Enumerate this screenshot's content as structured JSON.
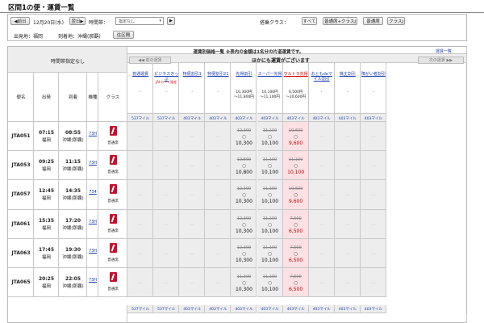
{
  "title": "区間1の便・運賃一覧",
  "search": {
    "prev_day": "◀前日",
    "date": "12月20日(水)",
    "next_day": "翌日▶",
    "time_label": "時間帯：",
    "time_value": "指定なし",
    "go": "▶",
    "class_label": "搭乗クラス：",
    "classes": [
      "すべて",
      "普通席+クラスJ",
      "普通席",
      "クラスJ"
    ],
    "origin": "出発地：福岡",
    "dest": "到着地：沖縄(那覇)",
    "reverse": "往区間"
  },
  "header": {
    "time_unspecified": "時間帯指定なし",
    "fare_title": "運賃別価格一覧 ※表内の金額は1名分の片道運賃です。",
    "fare_list_link": "運賃一覧",
    "prev_fares": "◀◀ 前の運賃",
    "other_fares": "ほかにも運賃がございます",
    "next_fares": "次の運賃 ▶▶",
    "col_flight": "便名",
    "col_dep": "出発",
    "col_arr": "到着",
    "col_aircraft": "機種",
    "col_class": "クラス"
  },
  "fares": [
    {
      "name": "普通運賃",
      "note": "",
      "price": "-",
      "red": false
    },
    {
      "name": "ビジネスきっぷ",
      "note": "JALカード限定",
      "price": "-",
      "red": false
    },
    {
      "name": "特便割引1",
      "note": "",
      "price": "-",
      "red": false
    },
    {
      "name": "特便割引21",
      "note": "",
      "price": "-",
      "red": false
    },
    {
      "name": "先得割引",
      "note": "",
      "price": "10,300円\n〜11,800円",
      "red": false
    },
    {
      "name": "スーパー先得",
      "note": "",
      "price": "10,100円\n〜11,100円",
      "red": false
    },
    {
      "name": "ウルトラ先得",
      "note": "",
      "price": "6,500円\n〜10,600円",
      "red": true
    },
    {
      "name": "おともdeマイル割引",
      "note": "",
      "price": "-",
      "red": false
    },
    {
      "name": "株主割引",
      "note": "",
      "price": "-",
      "red": false
    },
    {
      "name": "障がい者割引",
      "note": "",
      "price": "-",
      "red": false
    }
  ],
  "miles": [
    "537マイル",
    "537マイル",
    "403マイル",
    "403マイル",
    "403マイル",
    "403マイル",
    "403マイル",
    "403マイル",
    "403マイル",
    "403マイル"
  ],
  "class_name": "普通席",
  "flights": [
    {
      "no": "JTA051",
      "dep": "07:15",
      "from": "福岡",
      "arr": "08:55",
      "to": "沖縄(那覇)",
      "aircraft": "73H",
      "sakitoku": {
        "top": "12,300",
        "mark": "○",
        "price": "10,300"
      },
      "super": {
        "top": "11,100",
        "mark": "○",
        "price": "10,100"
      },
      "ultra": {
        "top": "10,600",
        "mark": "○",
        "price": "9,600"
      }
    },
    {
      "no": "JTA053",
      "dep": "09:25",
      "from": "福岡",
      "arr": "11:15",
      "to": "沖縄(那覇)",
      "aircraft": "73H",
      "sakitoku": {
        "top": "12,800",
        "mark": "○",
        "price": "10,800"
      },
      "super": {
        "top": "11,100",
        "mark": "○",
        "price": "10,100"
      },
      "ultra": {
        "top": "11,100",
        "mark": "○",
        "price": "10,100"
      }
    },
    {
      "no": "JTA057",
      "dep": "12:45",
      "from": "福岡",
      "arr": "14:35",
      "to": "沖縄(那覇)",
      "aircraft": "734",
      "sakitoku": {
        "top": "12,300",
        "mark": "○",
        "price": "10,300"
      },
      "super": {
        "top": "11,100",
        "mark": "○",
        "price": "10,100"
      },
      "ultra": {
        "top": "10,600",
        "mark": "○",
        "price": "9,600"
      }
    },
    {
      "no": "JTA061",
      "dep": "15:35",
      "from": "福岡",
      "arr": "17:20",
      "to": "沖縄(那覇)",
      "aircraft": "73H",
      "sakitoku": {
        "top": "12,300",
        "mark": "○",
        "price": "10,300"
      },
      "super": {
        "top": "11,100",
        "mark": "○",
        "price": "10,100"
      },
      "ultra": {
        "top": "7,500",
        "mark": "○",
        "price": "6,500"
      }
    },
    {
      "no": "JTA063",
      "dep": "17:45",
      "from": "福岡",
      "arr": "19:30",
      "to": "沖縄(那覇)",
      "aircraft": "73H",
      "sakitoku": {
        "top": "12,300",
        "mark": "○",
        "price": "10,300"
      },
      "super": {
        "top": "11,100",
        "mark": "○",
        "price": "10,100"
      },
      "ultra": {
        "top": "7,500",
        "mark": "○",
        "price": "6,500"
      }
    },
    {
      "no": "JTA065",
      "dep": "20:25",
      "from": "福岡",
      "arr": "22:05",
      "to": "沖縄(那覇)",
      "aircraft": "73H",
      "sakitoku": {
        "top": "11,300",
        "mark": "○",
        "price": "10,300"
      },
      "super": {
        "top": "11,100",
        "mark": "○",
        "price": "10,100"
      },
      "ultra": {
        "top": "7,500",
        "mark": "○",
        "price": "6,500"
      }
    }
  ]
}
